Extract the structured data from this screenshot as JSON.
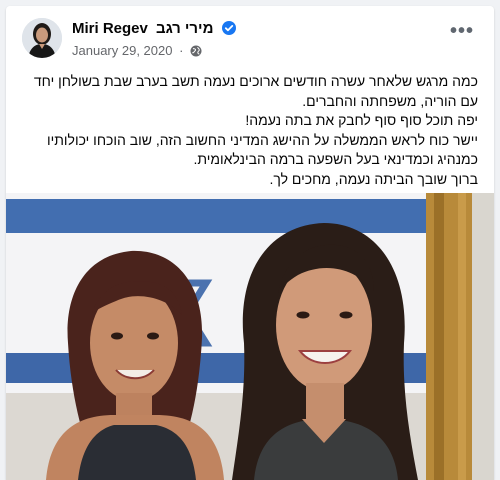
{
  "post": {
    "author": {
      "name_latin": "Miri Regev",
      "name_hebrew": "מירי רגב",
      "verified_icon": "verified-badge-icon"
    },
    "date": "January 29, 2020",
    "separator": "·",
    "privacy_icon": "globe-icon",
    "more_icon": "more-options-icon",
    "more_label": "•••",
    "text_lines": [
      "כמה מרגש שלאחר עשרה חודשים ארוכים נעמה תשב בערב שבת בשולחן יחד עם הוריה, משפחתה והחברים.",
      "יפה תוכל סוף סוף לחבק את בתה נעמה!",
      "יישר כוח לראש הממשלה על ההישג המדיני החשוב הזה, שוב הוכחו יכולותיו כמנהיג וכמדינאי בעל השפעה ברמה הבינלאומית.",
      "ברוך שובך הביתה נעמה, מחכים לך."
    ],
    "photo_description": "photo"
  },
  "colors": {
    "page_bg": "#f0f2f5",
    "card_bg": "#ffffff",
    "verified": "#1877f2",
    "meta_text": "#65676b"
  }
}
